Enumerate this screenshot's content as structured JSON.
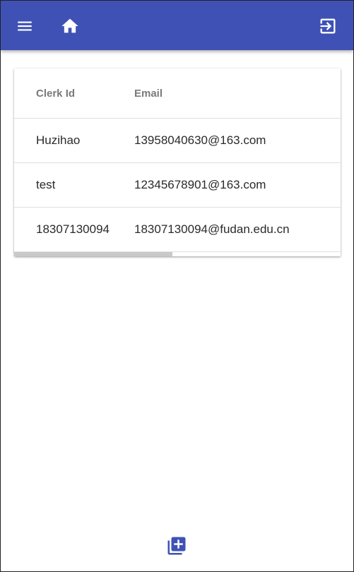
{
  "appbar": {
    "background": "#3f51b5",
    "menu_icon": "menu-icon",
    "home_icon": "home-icon",
    "logout_icon": "exit-to-app-icon"
  },
  "table": {
    "columns": [
      "Clerk Id",
      "Email"
    ],
    "rows": [
      {
        "clerk_id": "Huzihao",
        "email": "13958040630@163.com"
      },
      {
        "clerk_id": "test",
        "email": "12345678901@163.com"
      },
      {
        "clerk_id": "18307130094",
        "email": "18307130094@fudan.edu.cn"
      }
    ]
  },
  "fab": {
    "icon": "library-add-icon",
    "color": "#3f51b5"
  }
}
